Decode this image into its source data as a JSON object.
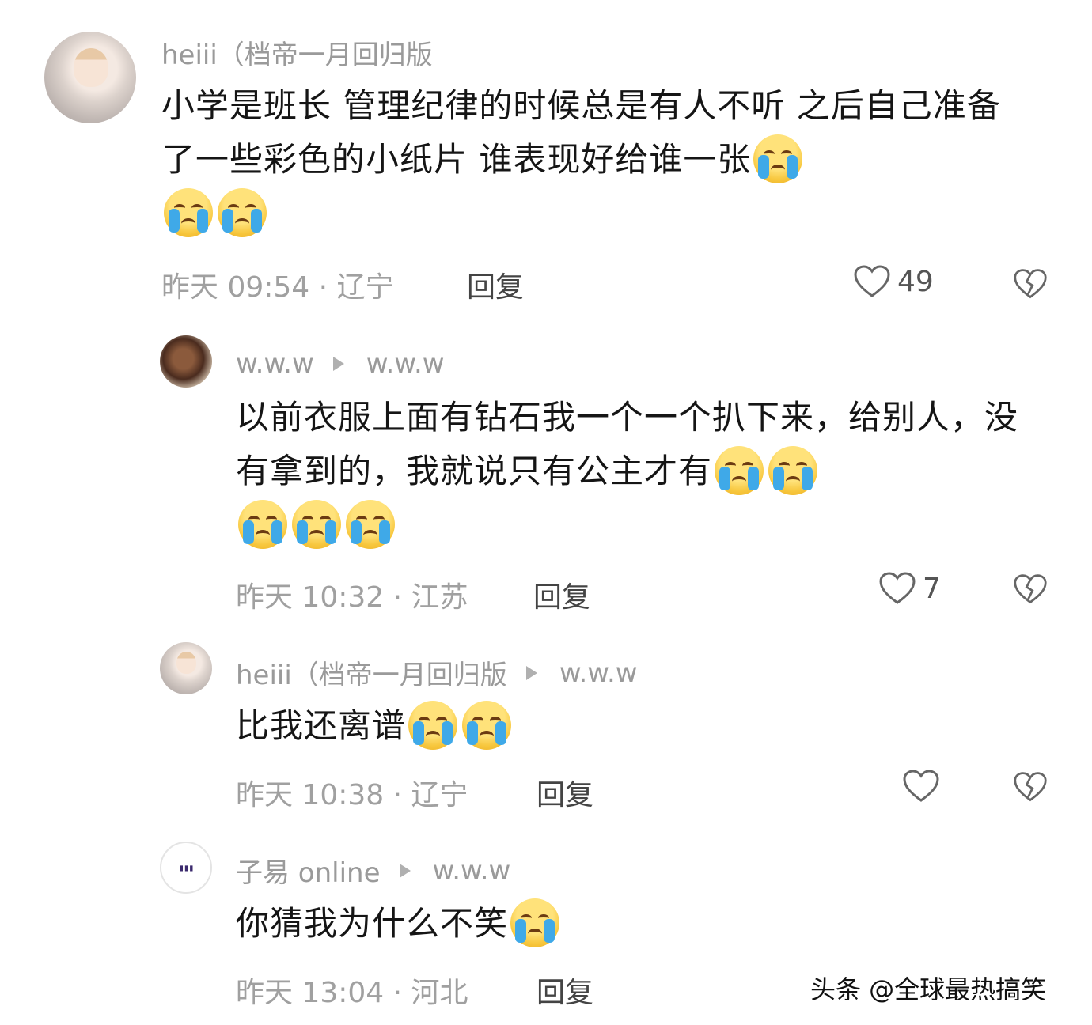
{
  "comments": [
    {
      "username": "heiii（档帝一月回归版",
      "text": "小学是班长 管理纪律的时候总是有人不听 之后自己准备了一些彩色的小纸片 谁表现好给谁一张",
      "emoji_count": 3,
      "meta": "昨天 09:54 · 辽宁",
      "reply_label": "回复",
      "likes": "49"
    },
    {
      "username": "w.w.w",
      "reply_to": "w.w.w",
      "text": "以前衣服上面有钻石我一个一个扒下来，给别人，没有拿到的，我就说只有公主才有",
      "emoji_count": 5,
      "meta": "昨天 10:32 · 江苏",
      "reply_label": "回复",
      "likes": "7"
    },
    {
      "username": "heiii（档帝一月回归版",
      "reply_to": "w.w.w",
      "text": "比我还离谱",
      "emoji_count": 2,
      "meta": "昨天 10:38 · 辽宁",
      "reply_label": "回复",
      "likes": ""
    },
    {
      "username": "子易 online",
      "reply_to": "w.w.w",
      "text": "你猜我为什么不笑",
      "emoji_count": 1,
      "meta": "昨天 13:04 · 河北",
      "reply_label": "回复",
      "likes": ""
    }
  ],
  "watermark": "头条 @全球最热搞笑",
  "colors": {
    "emoji_face": "#f7c63c",
    "tear": "#3fa9e8",
    "meta_gray": "#a0a0a0"
  },
  "icons": [
    "heart-icon",
    "broken-heart-icon",
    "reply-arrow-icon",
    "crying-emoji"
  ]
}
